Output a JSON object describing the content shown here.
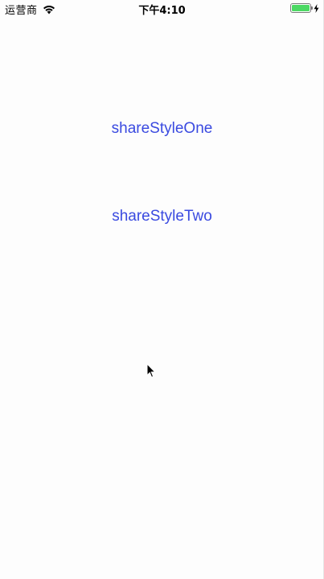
{
  "status_bar": {
    "carrier": "运营商",
    "time": "下午4:10",
    "wifi_icon": "wifi-icon",
    "battery_icon": "battery-icon",
    "charging_icon": "charging-bolt-icon",
    "battery_color": "#4cd964"
  },
  "main": {
    "share_style_one_label": "shareStyleOne",
    "share_style_two_label": "shareStyleTwo",
    "link_color": "#3a4ae0"
  },
  "cursor": {
    "icon": "mouse-pointer-icon"
  }
}
